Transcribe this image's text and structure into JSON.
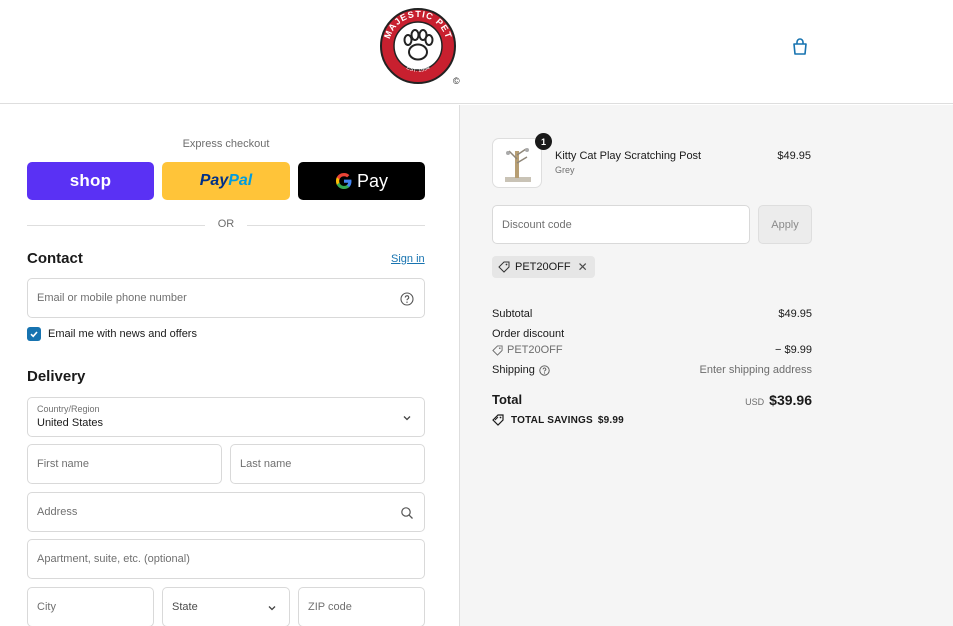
{
  "header": {
    "logo_text": "MAJESTIC PET",
    "logo_est": "EST. 1994",
    "logo_copyright": "©"
  },
  "express": {
    "title": "Express checkout",
    "shop_label": "shop",
    "paypal_label_1": "Pay",
    "paypal_label_2": "Pal",
    "gpay_label": "Pay",
    "or_label": "OR"
  },
  "contact": {
    "title": "Contact",
    "signin_label": "Sign in",
    "email_placeholder": "Email or mobile phone number",
    "newsletter_label": "Email me with news and offers",
    "newsletter_checked": true
  },
  "delivery": {
    "title": "Delivery",
    "country_label": "Country/Region",
    "country_value": "United States",
    "first_name_placeholder": "First name",
    "last_name_placeholder": "Last name",
    "address_placeholder": "Address",
    "apartment_placeholder": "Apartment, suite, etc. (optional)",
    "city_placeholder": "City",
    "state_label": "State",
    "zip_placeholder": "ZIP code"
  },
  "order": {
    "item": {
      "quantity": "1",
      "name": "Kitty Cat Play Scratching Post",
      "variant": "Grey",
      "price": "$49.95"
    },
    "discount_placeholder": "Discount code",
    "apply_label": "Apply",
    "applied_code": "PET20OFF",
    "subtotal_label": "Subtotal",
    "subtotal_value": "$49.95",
    "order_discount_label": "Order discount",
    "order_discount_code": "PET20OFF",
    "order_discount_value": "− $9.99",
    "shipping_label": "Shipping",
    "shipping_value": "Enter shipping address",
    "total_label": "Total",
    "total_currency": "USD",
    "total_value": "$39.96",
    "savings_label": "TOTAL SAVINGS",
    "savings_value": "$9.99"
  },
  "colors": {
    "shop_purple": "#5a31f4",
    "paypal_yellow": "#ffc439",
    "link_blue": "#1773b0",
    "logo_red": "#c8202f"
  }
}
